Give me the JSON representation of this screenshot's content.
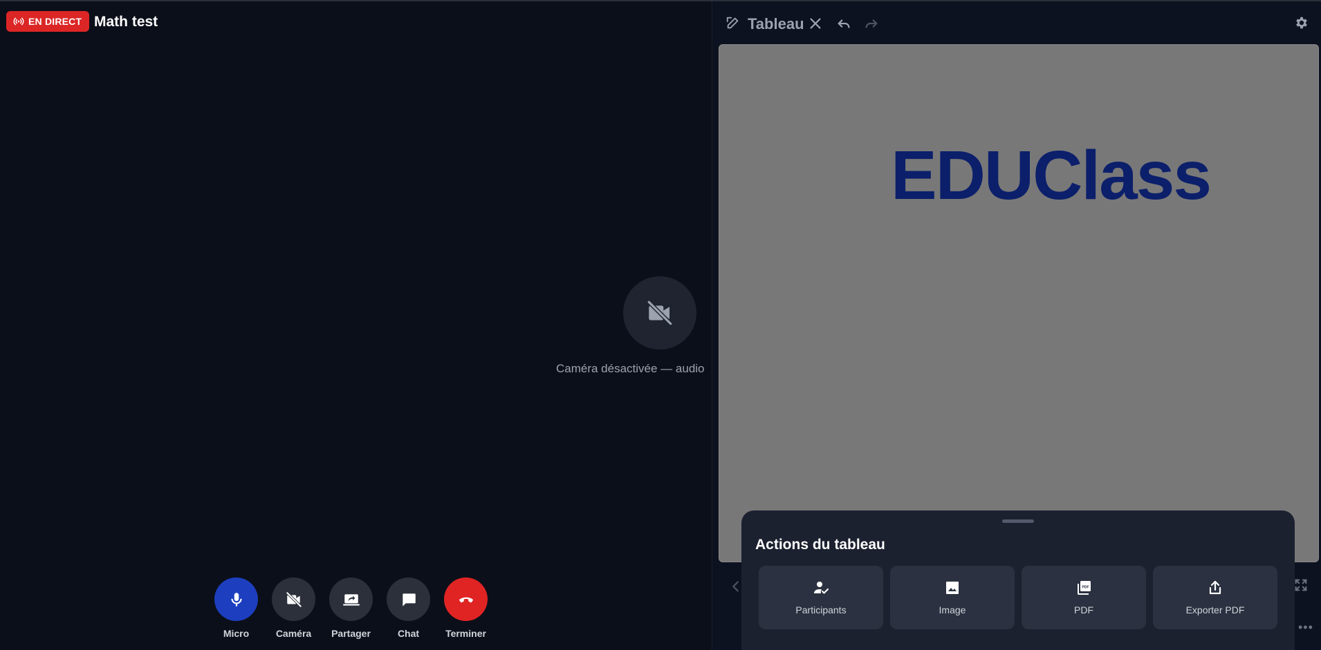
{
  "header": {
    "live_badge": "EN DIRECT",
    "room_title": "Math test"
  },
  "video": {
    "camera_off_text": "Caméra désactivée — audio"
  },
  "controls": [
    {
      "key": "mic",
      "label": "Micro",
      "icon": "microphone-icon"
    },
    {
      "key": "camera",
      "label": "Caméra",
      "icon": "camera-off-icon"
    },
    {
      "key": "share",
      "label": "Partager",
      "icon": "screen-share-icon"
    },
    {
      "key": "chat",
      "label": "Chat",
      "icon": "chat-icon"
    },
    {
      "key": "end",
      "label": "Terminer",
      "icon": "hang-up-icon"
    }
  ],
  "board": {
    "title": "Tableau",
    "canvas_text": "EDUClass"
  },
  "actions_sheet": {
    "title": "Actions du tableau",
    "actions": [
      {
        "key": "participants",
        "label": "Participants",
        "icon": "participants-icon"
      },
      {
        "key": "image",
        "label": "Image",
        "icon": "image-icon"
      },
      {
        "key": "pdf",
        "label": "PDF",
        "icon": "pdf-icon"
      },
      {
        "key": "export",
        "label": "Exporter PDF",
        "icon": "export-icon"
      }
    ]
  },
  "colors": {
    "background": "#0b0f19",
    "live_red": "#dc2626",
    "mic_blue": "#1d3fbf",
    "end_red": "#e02424",
    "board_gray": "#787878",
    "board_text": "#0b1f6b"
  }
}
